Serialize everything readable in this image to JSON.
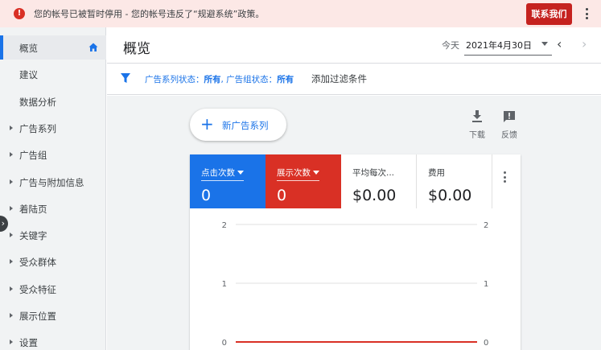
{
  "alert": {
    "message": "您的帐号已被暂时停用 - 您的帐号违反了“规避系统”政策。",
    "contact_label": "联系我们",
    "error_icon": "error-icon"
  },
  "sidebar": {
    "items": [
      {
        "label": "概览",
        "active": true,
        "caret": false
      },
      {
        "label": "建议",
        "active": false,
        "caret": false
      },
      {
        "label": "数据分析",
        "active": false,
        "caret": false
      },
      {
        "label": "广告系列",
        "active": false,
        "caret": true
      },
      {
        "label": "广告组",
        "active": false,
        "caret": true
      },
      {
        "label": "广告与附加信息",
        "active": false,
        "caret": true
      },
      {
        "label": "着陆页",
        "active": false,
        "caret": true
      },
      {
        "label": "关键字",
        "active": false,
        "caret": true
      },
      {
        "label": "受众群体",
        "active": false,
        "caret": true
      },
      {
        "label": "受众特征",
        "active": false,
        "caret": true
      },
      {
        "label": "展示位置",
        "active": false,
        "caret": true
      },
      {
        "label": "设置",
        "active": false,
        "caret": true
      }
    ]
  },
  "header": {
    "title": "概览",
    "date_prefix": "今天",
    "date_value": "2021年4月30日"
  },
  "filter": {
    "campaign_status_label": "广告系列状态：",
    "campaign_status_value": "所有",
    "adgroup_status_label": ", 广告组状态：",
    "adgroup_status_value": "所有",
    "add_filter_label": "添加过滤条件"
  },
  "main": {
    "new_campaign_label": "新广告系列",
    "download_label": "下载",
    "feedback_label": "反馈"
  },
  "metrics": [
    {
      "name": "点击次数",
      "value": "0",
      "color": "#1a73e8"
    },
    {
      "name": "展示次数",
      "value": "0",
      "color": "#d93025"
    },
    {
      "name": "平均每次...",
      "value": "$0.00",
      "color": "#ffffff"
    },
    {
      "name": "费用",
      "value": "$0.00",
      "color": "#ffffff"
    }
  ],
  "chart_data": {
    "type": "line",
    "left_axis_ticks": [
      "2",
      "1",
      "0"
    ],
    "right_axis_ticks": [
      "2",
      "1",
      "0"
    ],
    "ylim": [
      0,
      2
    ],
    "series": [
      {
        "values": [
          0,
          0,
          0,
          0
        ],
        "color": "#d93025"
      }
    ],
    "grid": true
  }
}
